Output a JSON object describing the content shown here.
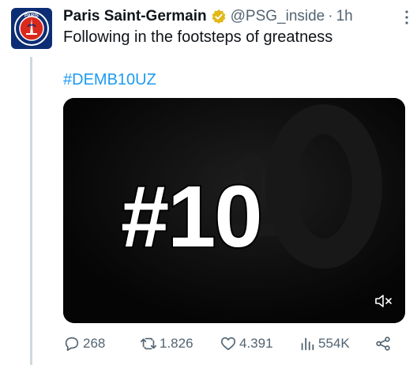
{
  "tweet": {
    "author_name": "Paris Saint-Germain",
    "handle": "@PSG_inside",
    "separator": "·",
    "time": "1h",
    "text": "Following in the footsteps of greatness",
    "hashtag": "#DEMB10UZ"
  },
  "avatar": {
    "badge_text": "PARIS",
    "colors": {
      "background": "#0c2d74",
      "ring": "#ffffff",
      "red": "#da291c"
    }
  },
  "media": {
    "overlay_text": "#10",
    "icon": "volume-muted-icon"
  },
  "actions": {
    "replies": "268",
    "reposts": "1.826",
    "likes": "4.391",
    "views": "554K"
  },
  "colors": {
    "verified": "#e2b719",
    "link": "#1d9bf0",
    "muted_text": "#536471"
  }
}
